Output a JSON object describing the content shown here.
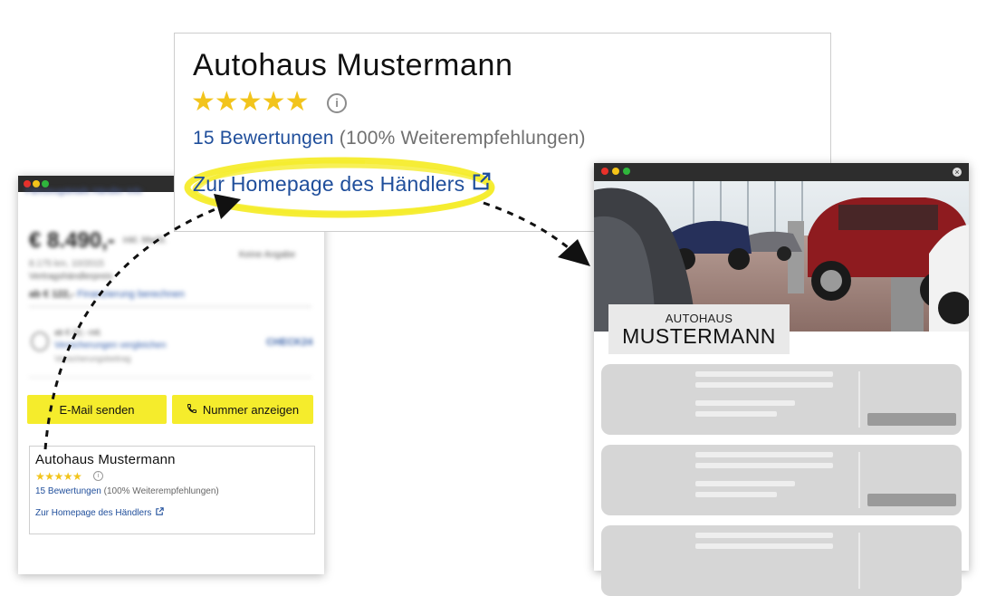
{
  "listing": {
    "breadcrumb": "Fahrzeugdetails Händler-Info",
    "price": "€ 8.490,-",
    "price_note": "inkl. MwSt.",
    "right_note": "Keine Angabe",
    "line1": "8.175 km, 10/2015",
    "line2": "Vertragshändlerpreis",
    "line3_prefix": "ab € 122,-",
    "line3_link": "Finanzierung berechnen",
    "insurance_line1": "ab € 22,- mtl.",
    "insurance_link": "Versicherungen vergleichen",
    "insurance_line3": "Versicherungsbeitrag",
    "insurance_brand": "CHECK24",
    "email_button": "E-Mail senden",
    "phone_button": "Nummer anzeigen"
  },
  "dealer": {
    "name": "Autohaus Mustermann",
    "stars": "★★★★★",
    "rating": 5,
    "info_glyph": "i",
    "reviews_link": "15 Bewertungen",
    "recommendation": "(100% Weiterempfehlungen)",
    "homepage_link": "Zur Homepage des Händlers"
  },
  "website": {
    "logo_small": "AUTOHAUS",
    "logo_big": "MUSTERMANN",
    "close_glyph": "×"
  },
  "colors": {
    "accent_yellow": "#f5ec2c",
    "star": "#f2c41c",
    "link_blue": "#1f4e9b",
    "window_bar": "#2d2d2d",
    "dot_red": "#e8312a",
    "dot_yellow": "#f5c418",
    "dot_green": "#2fb63c"
  }
}
